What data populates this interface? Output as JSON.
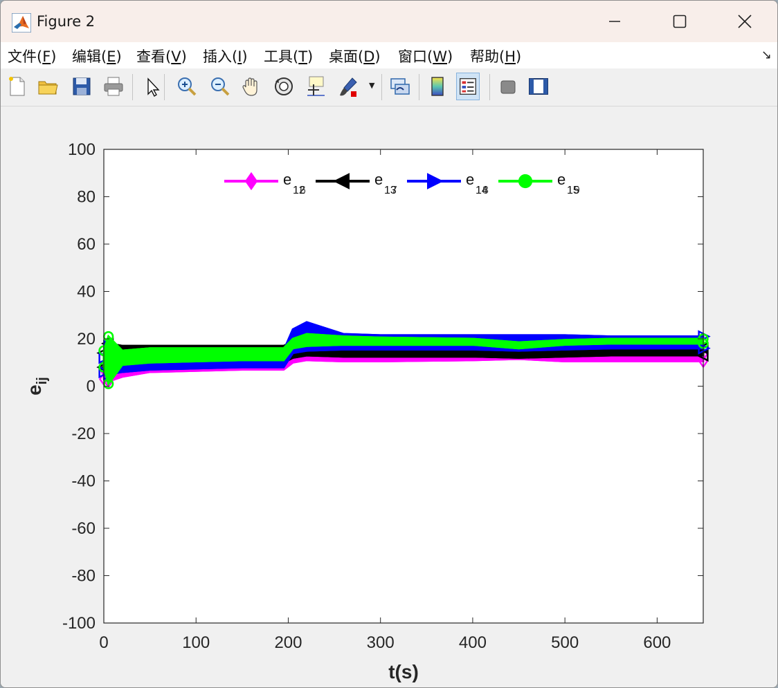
{
  "window": {
    "title": "Figure 2",
    "controls": {
      "minimize": "—",
      "maximize": "☐",
      "close": "✕"
    }
  },
  "menu": [
    {
      "pre": "文件(",
      "key": "F",
      "post": ")"
    },
    {
      "pre": "编辑(",
      "key": "E",
      "post": ")"
    },
    {
      "pre": "查看(",
      "key": "V",
      "post": ")"
    },
    {
      "pre": "插入(",
      "key": "I",
      "post": ")"
    },
    {
      "pre": "工具(",
      "key": "T",
      "post": ")"
    },
    {
      "pre": "桌面(",
      "key": "D",
      "post": ")"
    },
    {
      "pre": "窗口(",
      "key": "W",
      "post": ")"
    },
    {
      "pre": "帮助(",
      "key": "H",
      "post": ")"
    }
  ],
  "toolbar_icons": [
    "new-figure-icon",
    "open-file-icon",
    "save-icon",
    "print-icon",
    "select-arrow-icon",
    "zoom-in-icon",
    "zoom-out-icon",
    "pan-hand-icon",
    "rotate-3d-icon",
    "data-cursor-icon",
    "brush-icon",
    "link-plot-icon",
    "colorbar-icon",
    "legend-icon",
    "hide-plot-tools-icon",
    "show-plot-tools-icon"
  ],
  "chart_data": {
    "type": "line",
    "title": "",
    "xlabel": "t(s)",
    "ylabel": "e",
    "ylabel_sub": "ij",
    "xlim": [
      0,
      650
    ],
    "ylim": [
      -100,
      100
    ],
    "xticks": [
      0,
      100,
      200,
      300,
      400,
      500,
      600
    ],
    "yticks": [
      -100,
      -80,
      -60,
      -40,
      -20,
      0,
      20,
      40,
      60,
      80,
      100
    ],
    "grid": false,
    "legend_position": "top",
    "legend": [
      {
        "base": "e",
        "sub_a": "12",
        "sub_b": "6",
        "color": "#ff00ff",
        "marker": "diamond"
      },
      {
        "base": "e",
        "sub_a": "13",
        "sub_b": "7",
        "color": "#000000",
        "marker": "triangle-left"
      },
      {
        "base": "e",
        "sub_a": "14",
        "sub_b": "8",
        "color": "#0000ff",
        "marker": "triangle-right"
      },
      {
        "base": "e",
        "sub_a": "15",
        "sub_b": "9",
        "color": "#00ff00",
        "marker": "circle"
      }
    ],
    "series": [
      {
        "name": "e12",
        "color": "#ff00ff",
        "marker": "diamond",
        "x": [
          0,
          5,
          20,
          50,
          100,
          150,
          195,
          205,
          220,
          260,
          300,
          400,
          450,
          500,
          550,
          650
        ],
        "lower": [
          3,
          2,
          4,
          6,
          6.5,
          7,
          7,
          10,
          11,
          10.5,
          10.5,
          11,
          11.5,
          10.5,
          10.5,
          10.5
        ],
        "upper": [
          7,
          8,
          8,
          9,
          9.5,
          10,
          10,
          13,
          14,
          13.5,
          13.5,
          13.5,
          14,
          13.5,
          13.5,
          13.5
        ]
      },
      {
        "name": "e13",
        "color": "#000000",
        "marker": "triangle-left",
        "x": [
          0,
          5,
          20,
          50,
          100,
          150,
          195,
          205,
          220,
          260,
          300,
          400,
          450,
          500,
          550,
          650
        ],
        "lower": [
          8,
          8,
          9,
          10,
          10,
          10,
          10,
          12,
          13,
          12.5,
          12.5,
          12.5,
          12,
          12.5,
          13,
          13
        ],
        "upper": [
          14,
          18,
          17,
          17,
          17,
          17,
          17,
          19,
          21,
          19.5,
          19,
          17,
          15.5,
          15.5,
          16,
          16
        ]
      },
      {
        "name": "e14",
        "color": "#0000ff",
        "marker": "triangle-right",
        "x": [
          0,
          5,
          20,
          50,
          100,
          150,
          195,
          205,
          220,
          260,
          300,
          400,
          450,
          500,
          550,
          650
        ],
        "lower": [
          6,
          5,
          6,
          7,
          7.5,
          8,
          8,
          14,
          15,
          15.5,
          15.5,
          15.5,
          15,
          15.5,
          16,
          16
        ],
        "upper": [
          12,
          17,
          13,
          14,
          14.5,
          15,
          15,
          24,
          27,
          22,
          21.5,
          21.5,
          21.5,
          21.5,
          21,
          21
        ]
      },
      {
        "name": "e15",
        "color": "#00ff00",
        "marker": "circle",
        "x": [
          0,
          5,
          20,
          50,
          100,
          150,
          195,
          205,
          220,
          260,
          300,
          400,
          450,
          500,
          550,
          650
        ],
        "lower": [
          8,
          1,
          9,
          10,
          10.5,
          11,
          11,
          16,
          17,
          17.5,
          17.5,
          17.5,
          16,
          17.5,
          18,
          18
        ],
        "upper": [
          15,
          21,
          15,
          16,
          16,
          16,
          16,
          20,
          22,
          21,
          20.5,
          20,
          18.5,
          19.5,
          20,
          20
        ]
      }
    ]
  }
}
